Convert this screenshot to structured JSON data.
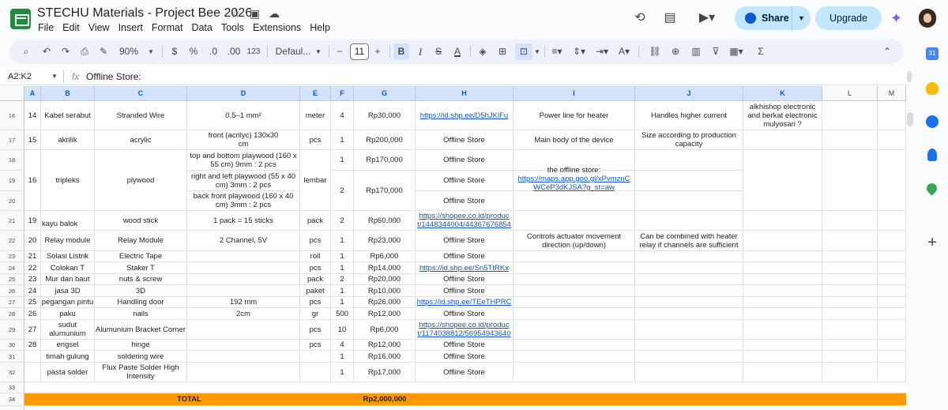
{
  "doc": {
    "title": "STECHU Materials - Project Bee 2026",
    "menu": [
      "File",
      "Edit",
      "View",
      "Insert",
      "Format",
      "Data",
      "Tools",
      "Extensions",
      "Help"
    ],
    "share_label": "Share",
    "upgrade_label": "Upgrade"
  },
  "toolbar": {
    "zoom": "90%",
    "currency": "$",
    "percent": "%",
    "dec_decrease": ".0",
    "dec_increase": ".00",
    "number_format": "123",
    "font": "Defaul...",
    "font_size": "11",
    "minus": "−",
    "plus": "+",
    "bold": "B",
    "italic": "I",
    "strike": "S",
    "sigma": "Σ"
  },
  "formula": {
    "name_box": "A2:K2",
    "fx": "fx",
    "value": "Offline Store:"
  },
  "columns": [
    "A",
    "B",
    "C",
    "D",
    "E",
    "F",
    "G",
    "H",
    "I",
    "J",
    "K",
    "L",
    "M"
  ],
  "rows": {
    "r16": {
      "num": "16",
      "a": "14",
      "b": "Kabel serabut",
      "c": "Stranded Wire",
      "d": "0.5–1 mm²",
      "e": "meter",
      "f": "4",
      "g": "Rp30,000",
      "h": "https://id.shp.ee/D5hJKlFu",
      "i": "Power line for heater",
      "j": "Handles higher current",
      "k": "alkhishop electronic and berkat electronic mulyosari ?"
    },
    "r17": {
      "num": "17",
      "a": "15",
      "b": "akrilik",
      "c": "acrylic",
      "d": "front  (acrilyc) 130x30 cm",
      "e": "pcs",
      "f": "1",
      "g": "Rp200,000",
      "h": "Offline Store",
      "i": "Main body of the device",
      "j": "Size according to production capacity"
    },
    "r18": {
      "num": "18",
      "d": "top and bottom playwood (160 x 55 cm) 9mm : 2 pcs",
      "f": "1",
      "g": "Rp170,000",
      "h": "Offline Store"
    },
    "r19": {
      "num": "19",
      "a": "16",
      "b": "tripleks",
      "c": "plywood",
      "d": "right and left playwood (55 x 40 cm) 3mm : 2 pcs",
      "e": "lembar",
      "h": "Offline Store",
      "i": "the offline store: https://maps.app.goo.gl/xPvmznCWCeP3dKJSA?g_st=aw"
    },
    "r20": {
      "num": "20",
      "d": "back front playwood (160 x 40 cm) 3mm : 2 pcs",
      "f": "2",
      "g": "Rp170,000",
      "h": "Offline Store"
    },
    "r21": {
      "num": "21",
      "a": "19",
      "b": "kayu balok",
      "c": "wood stick",
      "d": "1 pack = 15 sticks",
      "e": "pack",
      "f": "2",
      "g": "Rp60,000",
      "h": "https://shopee.co.id/product/1448344004/44367676854"
    },
    "r22": {
      "num": "22",
      "a": "20",
      "b": "Relay module",
      "c": "Relay Module",
      "d": "2 Channel, 5V",
      "e": "pcs",
      "f": "1",
      "g": "Rp23,000",
      "h": "Offline Store",
      "i": "Controls actuator movement direction (up/down)",
      "j": "Can be combined with heater relay if channels are sufficient"
    },
    "r23": {
      "num": "23",
      "a": "21",
      "b": "Solasi Listrik",
      "c": "Electric Tape",
      "e": "roll",
      "f": "1",
      "g": "Rp6,000",
      "h": "Offline Store"
    },
    "r24": {
      "num": "24",
      "a": "22",
      "b": "Colokan T",
      "c": "Staker T",
      "e": "pcs",
      "f": "1",
      "g": "Rp14,000",
      "h": "https://id.shp.ee/Sn5TtRKx"
    },
    "r25": {
      "num": "25",
      "a": "23",
      "b": "Mur dan baut",
      "c": "nuts & screw",
      "e": "pack",
      "f": "2",
      "g": "Rp20,000",
      "h": "Offline Store"
    },
    "r26": {
      "num": "26",
      "a": "24",
      "b": "jasa 3D",
      "c": "3D",
      "e": "paket",
      "f": "1",
      "g": "Rp10,000",
      "h": "Offline Store"
    },
    "r27": {
      "num": "27",
      "a": "25",
      "b": "pegangan pintu",
      "c": "Handling door",
      "d": "192 mm",
      "e": "pcs",
      "f": "1",
      "g": "Rp26,000",
      "h": "https://id.shp.ee/TEeTHPRC"
    },
    "r28": {
      "num": "28",
      "a": "26",
      "b": "paku",
      "c": "nails",
      "d": "2cm",
      "e": "gr",
      "f": "500",
      "g": "Rp12,000",
      "h": "Offline Store"
    },
    "r29": {
      "num": "29",
      "a": "27",
      "b": "sudut alumunium",
      "c": "Alumunium Bracket Corner",
      "e": "pcs",
      "f": "10",
      "g": "Rp6,000",
      "h": "https://shopee.co.id/product/1174038812/56954943640"
    },
    "r30": {
      "num": "30",
      "a": "28",
      "b": "engsel",
      "c": "hinge",
      "e": "pcs",
      "f": "4",
      "g": "Rp12,000",
      "h": "Offline Store"
    },
    "r31": {
      "num": "31",
      "b": "timah gulung",
      "c": "soldering wire",
      "f": "1",
      "g": "Rp16,000",
      "h": "Offline Store"
    },
    "r32": {
      "num": "32",
      "b": "pasta solder",
      "c": "Flux Paste Solder High Intensity",
      "f": "1",
      "g": "Rp17,000",
      "h": "Offline Store"
    },
    "r33": {
      "num": "33"
    },
    "r34": {
      "num": "34",
      "total_label": "TOTAL",
      "total_value": "Rp2,000,000"
    }
  },
  "colors": {
    "accent": "#0b57d0",
    "total_fill": "#ff9900",
    "link": "#1155cc",
    "logo": "#1e8e3e"
  }
}
